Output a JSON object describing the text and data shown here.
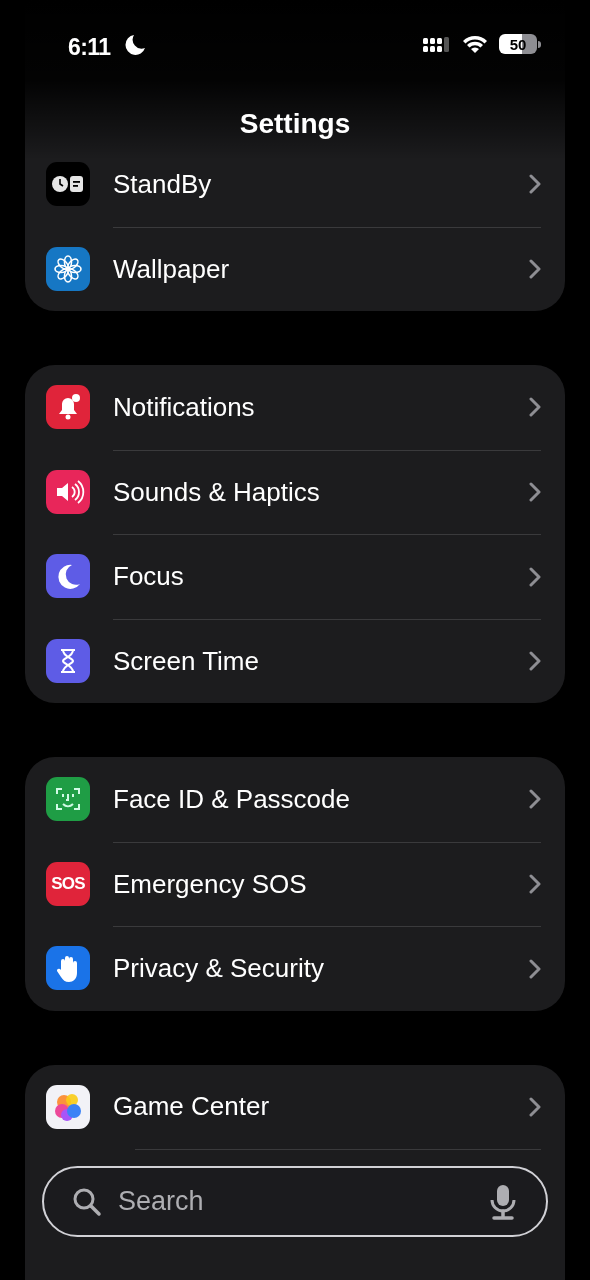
{
  "status_bar": {
    "time": "6:11",
    "focus_moon": true,
    "battery": "50"
  },
  "title": "Settings",
  "groups": [
    {
      "rows": [
        {
          "label": "StandBy"
        },
        {
          "label": "Wallpaper"
        }
      ]
    },
    {
      "rows": [
        {
          "label": "Notifications"
        },
        {
          "label": "Sounds & Haptics"
        },
        {
          "label": "Focus"
        },
        {
          "label": "Screen Time"
        }
      ]
    },
    {
      "rows": [
        {
          "label": "Face ID & Passcode"
        },
        {
          "label": "Emergency SOS",
          "icon_text": "SOS"
        },
        {
          "label": "Privacy & Security"
        }
      ]
    },
    {
      "rows": [
        {
          "label": "Game Center"
        }
      ]
    }
  ],
  "search": {
    "placeholder": "Search"
  }
}
